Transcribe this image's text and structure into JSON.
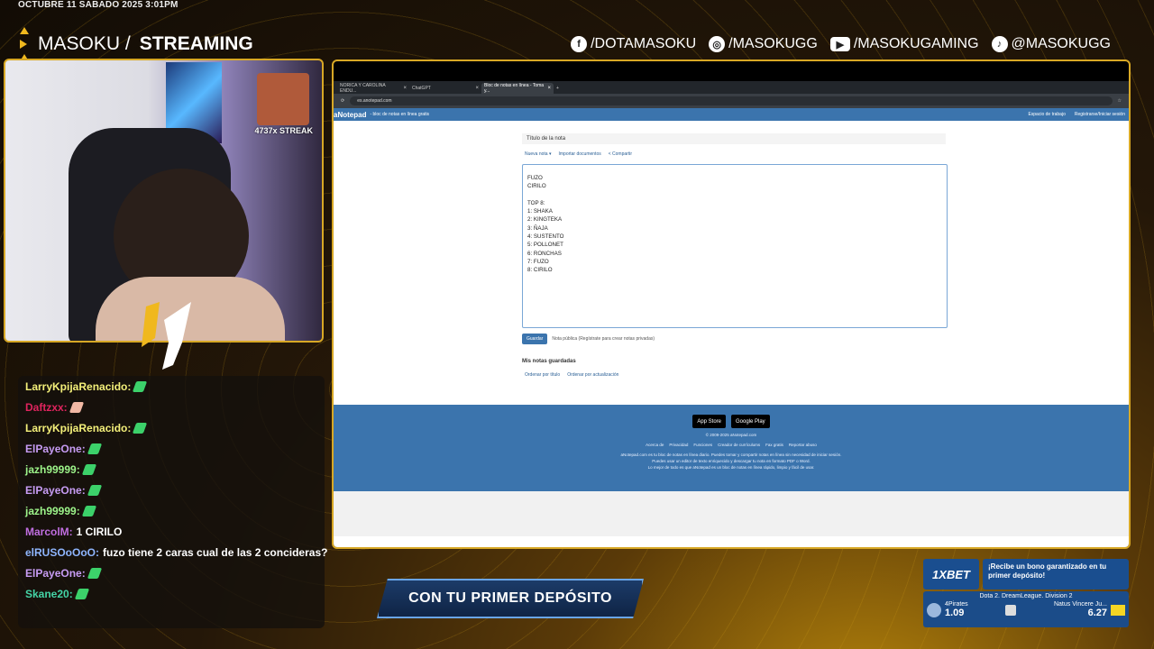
{
  "overlay": {
    "datetime": "OCTUBRE 11 SABADO 2025 3:01PM",
    "brand_light": "MASOKU /",
    "brand_bold": "STREAMING",
    "socials": [
      {
        "icon": "facebook-icon",
        "label": "/DOTAMASOKU"
      },
      {
        "icon": "instagram-icon",
        "label": "/MASOKUGG"
      },
      {
        "icon": "youtube-icon",
        "label": "/MASOKUGAMING"
      },
      {
        "icon": "tiktok-icon",
        "label": "@MASOKUGG"
      }
    ],
    "streak": "4737x STREAK",
    "promo": "CON TU PRIMER DEPÓSITO"
  },
  "chat": [
    {
      "user": "LarryKpijaRenacido:",
      "color": "#f4f07a",
      "text": "",
      "emote": "pickaxe"
    },
    {
      "user": "Daftzxx:",
      "color": "#e0245e",
      "text": "",
      "emote": "hand"
    },
    {
      "user": "LarryKpijaRenacido:",
      "color": "#f4f07a",
      "text": "",
      "emote": "pickaxe"
    },
    {
      "user": "ElPayeOne:",
      "color": "#c79cf4",
      "text": "",
      "emote": "pickaxe"
    },
    {
      "user": "jazh99999:",
      "color": "#9df48a",
      "text": "",
      "emote": "pickaxe"
    },
    {
      "user": "ElPayeOne:",
      "color": "#c79cf4",
      "text": "",
      "emote": "pickaxe"
    },
    {
      "user": "jazh99999:",
      "color": "#9df48a",
      "text": "",
      "emote": "pickaxe"
    },
    {
      "user": "MarcolM:",
      "color": "#c06ee0",
      "text": "1 CIRILO",
      "emote": ""
    },
    {
      "user": "elRUSOoOoO:",
      "color": "#8fb6ff",
      "text": "fuzo tiene 2 caras cual de las 2 concideras?",
      "emote": ""
    },
    {
      "user": "ElPayeOne:",
      "color": "#c79cf4",
      "text": "",
      "emote": "pickaxe"
    },
    {
      "user": "Skane20:",
      "color": "#44d4a6",
      "text": "",
      "emote": "pickaxe"
    }
  ],
  "browser": {
    "tabs": [
      {
        "label": "NORICA Y CAROLINA ENDU...",
        "active": false
      },
      {
        "label": "ChatGPT",
        "active": false
      },
      {
        "label": "Bloc de notas en línea - Toma y...",
        "active": true
      }
    ],
    "new_tab": "+",
    "url": "es.anotepad.com"
  },
  "site": {
    "logo": "aNotepad",
    "tagline": "- bloc de notas en línea gratis",
    "nav_right": [
      "Espacio de trabajo",
      "Registrarse/Iniciar sesión"
    ],
    "title_placeholder": "Título de la nota",
    "actions": [
      "Nueva nota ▾",
      "Importar documentos",
      "< Compartir"
    ],
    "note_lines": [
      "FUZO",
      "CIRILO",
      "",
      "TOP 8:",
      "1: SHAKA",
      "2: KINGTEKA",
      "3: ÑAJA",
      "4: SUSTENTO",
      "5: POLLONET",
      "6: RONCHAS",
      "7: FUZO",
      "8: CIRILO"
    ],
    "save": "Guardar",
    "public_note": "Nota pública (Regístrate para crear notas privadas)",
    "saved_heading": "Mis notas guardadas",
    "sort": [
      "Ordenar por título",
      "Ordenar por actualización"
    ],
    "stores": [
      "App Store",
      "Google Play"
    ],
    "copyright": "© 2009-2025 aNotepad.com",
    "footer_links": [
      "Acerca de",
      "Privacidad",
      "Funciones",
      "Creador de currículums",
      "Fax gratis",
      "Reportar abuso"
    ],
    "footer_desc": [
      "aNotepad.com es tu bloc de notas en línea diario. Puedes tomar y compartir notas en línea sin necesidad de iniciar sesión.",
      "Puedes usar un editor de texto enriquecido y descargar tu nota en formato PDF o Word.",
      "Lo mejor de todo es que aNotepad es un bloc de notas en línea rápido, limpio y fácil de usar."
    ]
  },
  "betting": {
    "logo": "1XBET",
    "text": "¡Recibe un bono garantizado en tu primer depósito!",
    "league": "Dota 2. DreamLeague. Division 2",
    "team1": "4Pirates",
    "odd1": "1.09",
    "team2": "Natus Vincere Ju...",
    "odd2": "6.27"
  }
}
